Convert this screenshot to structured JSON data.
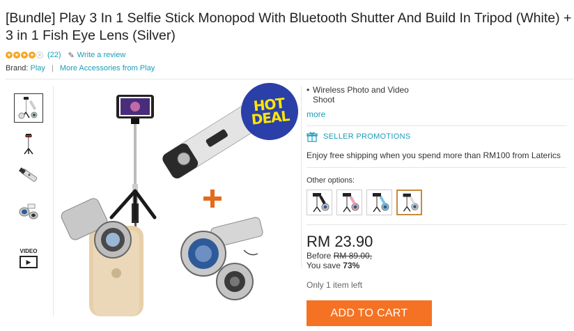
{
  "product": {
    "title": "[Bundle] Play 3 In 1 Selfie Stick Monopod With Bluetooth Shutter And Build In Tripod (White) + 3 in 1 Fish Eye Lens (Silver)",
    "rating": 4,
    "rating_max": 5,
    "review_count": "(22)",
    "write_review": "Write a review",
    "brand_label": "Brand:",
    "brand": "Play",
    "brand_separator": "|",
    "more_from_brand": "More Accessories from Play"
  },
  "gallery": {
    "video_label": "VIDEO",
    "badge_line1": "HOT",
    "badge_line2": "DEAL",
    "badge_color": "#2a3fa8",
    "badge_text_color": "#ffe600"
  },
  "highlights": {
    "bullet_line1": "Wireless Photo and Video",
    "bullet_line2": "Shoot",
    "more_link": "more"
  },
  "promotions": {
    "heading": "SELLER PROMOTIONS",
    "text": "Enjoy free shipping when you spend more than RM100 from Laterics"
  },
  "options": {
    "label": "Other options:",
    "selected_index": 3,
    "count": 4
  },
  "pricing": {
    "price": "RM 23.90",
    "before_label": "Before",
    "before_price": "RM 89.00,",
    "save_label": "You save",
    "save_percent": "73%"
  },
  "stock": "Only 1 item left",
  "cart_button": "ADD TO CART",
  "colors": {
    "accent": "#1a9cb7",
    "cart": "#f57224",
    "star": "#f5a623"
  }
}
